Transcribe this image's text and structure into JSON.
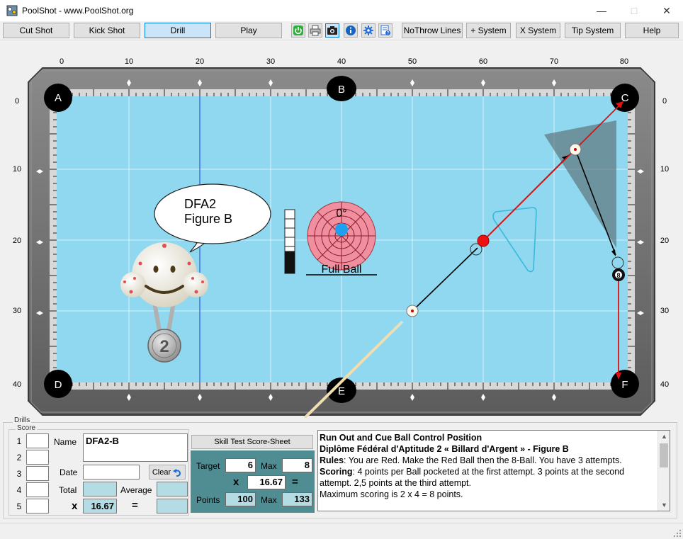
{
  "window": {
    "title": "PoolShot - www.PoolShot.org"
  },
  "toolbar": {
    "cut_shot": "Cut Shot",
    "kick_shot": "Kick Shot",
    "drill": "Drill",
    "play": "Play",
    "no_throw_lines": "NoThrow Lines",
    "plus_system": "+ System",
    "x_system": "X System",
    "tip_system": "Tip System",
    "help": "Help"
  },
  "table": {
    "x_ruler": [
      "0",
      "10",
      "20",
      "30",
      "40",
      "50",
      "60",
      "70",
      "80"
    ],
    "y_ruler": [
      "0",
      "10",
      "20",
      "30",
      "40"
    ],
    "pockets": [
      "A",
      "B",
      "C",
      "D",
      "E",
      "F"
    ],
    "eight_ball": "8",
    "felt_color": "#8fd8ef",
    "rail_color": "#6e6e6e"
  },
  "mascot": {
    "speech_line1": "DFA2",
    "speech_line2": "Figure B",
    "medal_number": "2"
  },
  "cue_indicator": {
    "angle": "0°",
    "label": "Full Ball",
    "power_level": 0.35
  },
  "drills": {
    "group_label": "Drills",
    "score_label": "Score",
    "score_rows": [
      "1",
      "2",
      "3",
      "4",
      "5"
    ],
    "name_label": "Name",
    "name_value": "DFA2-B",
    "date_label": "Date",
    "date_value": "",
    "clear_label": "Clear",
    "total_label": "Total",
    "average_label": "Average",
    "x_sign": "x",
    "eq_sign": "=",
    "multiplier": "16.67"
  },
  "skill_test": {
    "button_label": "Skill Test Score-Sheet",
    "target_label": "Target",
    "target_value": "6",
    "max_label": "Max",
    "max_value": "8",
    "x_sign": "x",
    "multiplier": "16.67",
    "eq_sign": "=",
    "points_label": "Points",
    "points_value": "100",
    "points_max_label": "Max",
    "points_max_value": "133"
  },
  "description": {
    "title1": "Run Out and Cue Ball Control Position",
    "title2": "Diplôme Fédéral d'Aptitude 2 « Billard d'Argent » - Figure B",
    "rules_label": "Rules",
    "rules_text": ": You are Red. Make the Red Ball then the 8-Ball. You have 3 attempts.",
    "scoring_label": "Scoring",
    "scoring_text": ": 4 points per Ball pocketed at the first attempt. 3 points at the second attempt. 2,5 points at the third attempt.",
    "max_text": "Maximum scoring is 2 x 4 = 8 points."
  }
}
